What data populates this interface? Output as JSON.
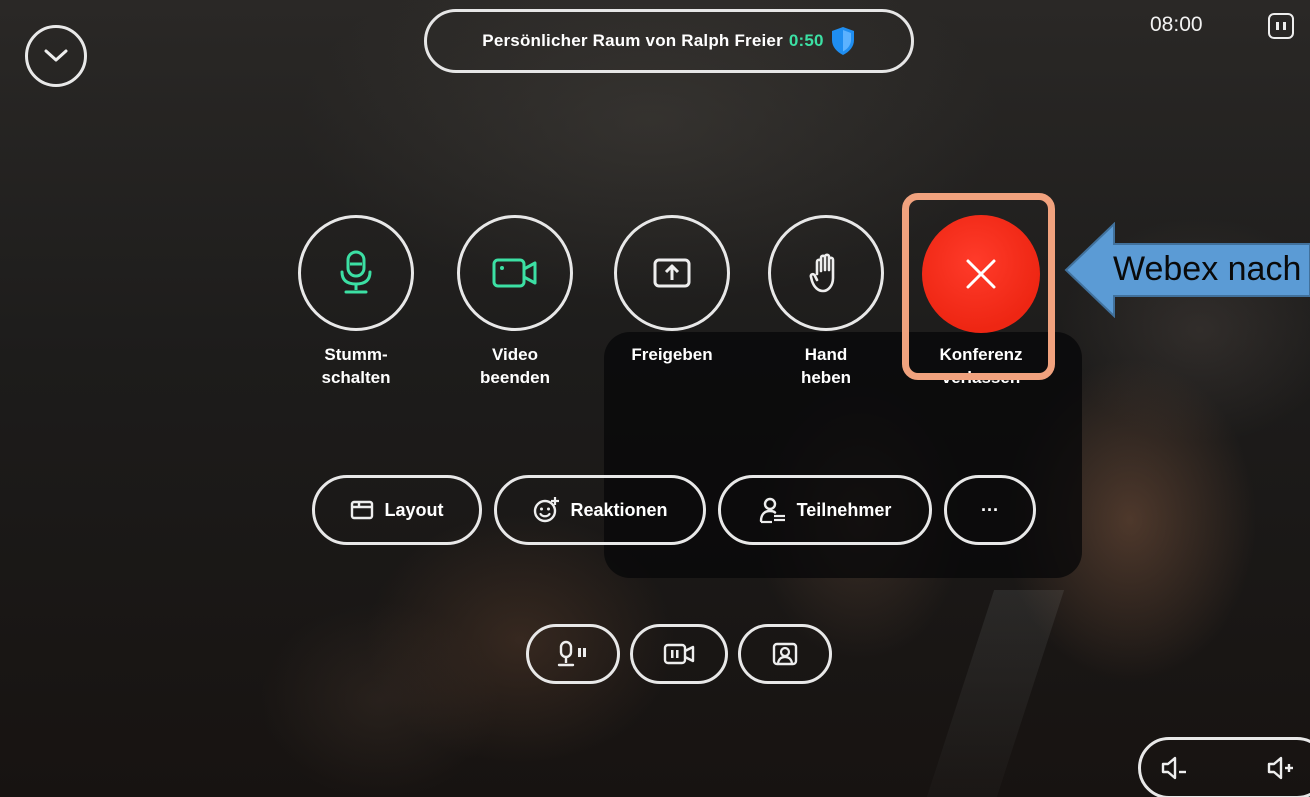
{
  "header": {
    "meeting_title": "Persönlicher Raum von Ralph Freier",
    "meeting_timer": "0:50",
    "clock": "08:00"
  },
  "controls": {
    "mute_label": "Stumm-\nschalten",
    "video_label": "Video\nbeenden",
    "share_label": "Freigeben",
    "hand_label": "Hand\nheben",
    "leave_label": "Konferenz\nverlassen"
  },
  "pills": {
    "layout_label": "Layout",
    "reactions_label": "Reaktionen",
    "participants_label": "Teilnehmer",
    "more_label": "···"
  },
  "annotation": {
    "text": "Webex nach"
  },
  "colors": {
    "accent_green": "#3ce0a4",
    "end_call_red": "#ee2613",
    "shield_blue": "#1f8ef1",
    "highlight_orange": "#f1a27e",
    "callout_blue": "#5b9bd5"
  },
  "icons": {
    "collapse": "chevron-down-icon",
    "security": "shield-icon",
    "compact": "compact-view-icon",
    "mute": "microphone-icon",
    "video": "camera-icon",
    "share": "share-screen-icon",
    "hand": "hand-icon",
    "leave": "close-icon",
    "layout": "layout-icon",
    "reactions": "emoji-icon",
    "participants": "participants-icon",
    "more": "more-icon",
    "mini_mic": "mic-mini-icon",
    "mini_cam": "camera-mini-icon",
    "self_view": "self-view-icon",
    "volume_down": "volume-down-icon",
    "volume_up": "volume-up-icon"
  }
}
